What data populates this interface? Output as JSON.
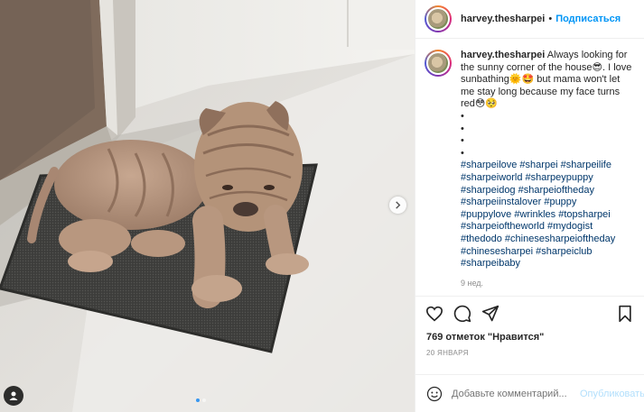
{
  "header": {
    "username": "harvey.thesharpei",
    "separator": "•",
    "follow_label": "Подписаться"
  },
  "caption": {
    "username": "harvey.thesharpei",
    "text_part1": "Always looking for the sunny corner of the house",
    "emoji1": "😎",
    "text_part2": ". I love sunbathing",
    "emoji2": "🌞",
    "emoji3": "🤩",
    "text_part3": " but mama won't let me stay long because my face turns red",
    "emoji4": "😳",
    "emoji5": "🥺",
    "bullets": [
      "•",
      "•",
      "•",
      "•"
    ],
    "hashtags": [
      "#sharpeilove #sharpei #sharpeilife",
      "#sharpeiworld #sharpeypuppy",
      "#sharpeidog #sharpeioftheday",
      "#sharpeiinstalover #puppy",
      "#puppylove #wrinkles #topsharpei",
      "#sharpeioftheworld #mydogist",
      "#thedodo #chinesesharpeioftheday",
      "#chinesesharpei #sharpeiclub",
      "#sharpeibaby"
    ],
    "age": "9 нед."
  },
  "actions": {
    "icons": [
      "heart-icon",
      "comment-icon",
      "share-icon",
      "bookmark-icon"
    ]
  },
  "likes": "769 отметок \"Нравится\"",
  "date": "20 ЯНВАРЯ",
  "add_comment": {
    "placeholder": "Добавьте комментарий...",
    "post_label": "Опубликовать"
  },
  "carousel": {
    "slide_count": 2,
    "active_slide": 1
  },
  "colors": {
    "accent": "#0095f6",
    "hashtag": "#00376b",
    "muted": "#8e8e8e"
  }
}
